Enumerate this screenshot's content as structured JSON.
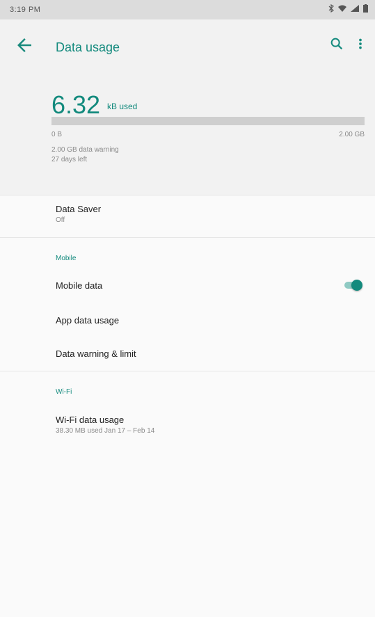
{
  "status_bar": {
    "time": "3:19 PM",
    "right_icons": [
      "bluetooth-icon",
      "wifi-icon",
      "signal-icon",
      "battery-icon"
    ]
  },
  "app_bar": {
    "title": "Data usage",
    "back_icon": "arrow-left-icon",
    "search_icon": "search-icon",
    "more_icon": "more-vert-icon"
  },
  "summary": {
    "value": "6.32",
    "unit": "kB used",
    "progress_fraction": 0.0,
    "bar_min_label": "0 B",
    "bar_max_label": "2.00 GB",
    "warning_text": "2.00 GB data warning",
    "days_left_text": "27 days left"
  },
  "data_saver": {
    "title": "Data Saver",
    "status": "Off"
  },
  "mobile_section": {
    "header": "Mobile",
    "mobile_data_label": "Mobile data",
    "mobile_data_on": true,
    "app_data_usage_label": "App data usage",
    "data_warning_limit_label": "Data warning & limit"
  },
  "wifi_section": {
    "header": "Wi-Fi",
    "wifi_data_usage_label": "Wi-Fi data usage",
    "wifi_data_usage_summary": "38.30 MB used Jan 17 – Feb 14"
  },
  "colors": {
    "accent": "#138a7d",
    "background": "#fafafa",
    "header_bg": "#f2f2f2",
    "status_bar_bg": "#dcdcdc"
  }
}
